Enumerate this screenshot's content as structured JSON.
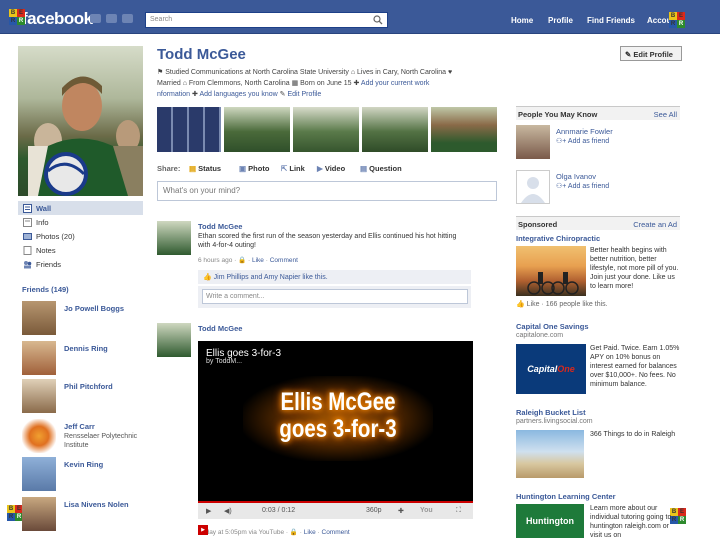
{
  "topbar": {
    "logo": "facebook",
    "search_placeholder": "Search",
    "nav": [
      "Home",
      "Profile",
      "Find Friends",
      "Account"
    ]
  },
  "profile": {
    "name": "Todd McGee",
    "edit_button": "Edit Profile",
    "info_line1": "Studied Communications at North Carolina State University",
    "info_lives": "Lives in Cary, North Carolina",
    "info_line2a": "Married",
    "info_from": "From Clemmons, North Carolina",
    "info_born": "Born on June 15",
    "info_add_town": "Add your current work",
    "info_line3a": "nformation",
    "info_add_lang": "Add languages you know",
    "info_edit": "Edit Profile"
  },
  "left_nav": {
    "wall": "Wall",
    "info": "Info",
    "photos": "Photos (20)",
    "notes": "Notes",
    "friends": "Friends"
  },
  "friends": {
    "heading": "Friends (149)",
    "items": [
      {
        "name": "Jo Powell Boggs",
        "sub": ""
      },
      {
        "name": "Dennis Ring",
        "sub": ""
      },
      {
        "name": "Phil Pitchford",
        "sub": ""
      },
      {
        "name": "Jeff Carr",
        "sub": "Rensselaer Polytechnic Institute"
      },
      {
        "name": "Kevin Ring",
        "sub": ""
      },
      {
        "name": "Lisa Nivens Nolen",
        "sub": ""
      }
    ]
  },
  "share": {
    "label": "Share:",
    "status": "Status",
    "photo": "Photo",
    "link": "Link",
    "video": "Video",
    "question": "Question",
    "placeholder": "What's on your mind?"
  },
  "post1": {
    "author": "Todd McGee",
    "text": "Ethan scored the first run of the season yesterday and Ellis continued his hot hitting with 4-for-4 outing!",
    "meta": "6 hours ago",
    "like": "Like",
    "comment": "Comment",
    "likes_text": "Jim Phillips and Amy Napier like this.",
    "comment_placeholder": "Write a comment..."
  },
  "post2": {
    "author": "Todd McGee",
    "video_title": "Ellis goes 3-for-3",
    "video_sub": "by ToddM...",
    "video_overlay": "Ellis McGee goes 3-for-3",
    "time": "0:03 / 0:12",
    "quality": "360p",
    "meta": "Friday at 5:05pm via YouTube",
    "like": "Like",
    "comment": "Comment"
  },
  "pymk": {
    "heading": "People You May Know",
    "see_all": "See All",
    "people": [
      {
        "name": "Annmarie Fowler",
        "add": "Add as friend"
      },
      {
        "name": "Olga Ivanov",
        "add": "Add as friend"
      }
    ]
  },
  "sponsored": {
    "heading": "Sponsored",
    "create_ad": "Create an Ad",
    "ads": [
      {
        "title": "Integrative Chiropractic",
        "domain": "",
        "text": "Better health begins with better nutrition, better lifestyle, not more pill of you. Join just your done. Like us to learn more!",
        "like": "Like · 166 people like this."
      },
      {
        "title": "Capital One Savings",
        "domain": "capitalone.com",
        "text": "Get Paid. Twice. Earn 1.05% APY on 10% bonus on interest earned for balances over $10,000+. No fees. No minimum balance.",
        "like": ""
      },
      {
        "title": "Raleigh Bucket List",
        "domain": "partners.livingsocial.com",
        "text": "366 Things to do in Raleigh",
        "like": ""
      },
      {
        "title": "Huntington Learning Center",
        "domain": "",
        "text": "Learn more about our individual tutoring going to huntington raleigh.com or visit us on",
        "like": ""
      }
    ]
  },
  "colors": {
    "brand": "#3b5998",
    "tile_red": "#d9281b",
    "tile_green": "#2d8a2d",
    "tile_yellow": "#e9c41a",
    "tile_blue": "#2757a8"
  }
}
